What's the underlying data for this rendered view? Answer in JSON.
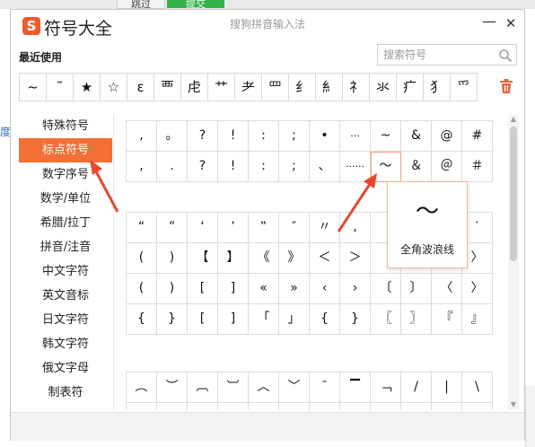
{
  "background": {
    "tab_skip": "跳过",
    "tab_submit": "提交",
    "left_link": "度"
  },
  "window": {
    "logo_letter": "S",
    "title": "符号大全",
    "ime_name": "搜狗拼音输入法",
    "minimize_symbol": "—",
    "close_symbol": "✕"
  },
  "recent": {
    "label": "最近使用",
    "symbols": [
      "~",
      "˜",
      "★",
      "☆",
      "ε",
      "覀",
      "虍",
      "艹",
      "耂",
      "罒",
      "纟",
      "糹",
      "礻",
      "氺",
      "疒",
      "犭",
      "爫"
    ]
  },
  "search": {
    "placeholder": "搜索符号"
  },
  "sidebar": {
    "items": [
      {
        "label": "特殊符号",
        "active": false
      },
      {
        "label": "标点符号",
        "active": true
      },
      {
        "label": "数字序号",
        "active": false
      },
      {
        "label": "数学/单位",
        "active": false
      },
      {
        "label": "希腊/拉丁",
        "active": false
      },
      {
        "label": "拼音/注音",
        "active": false
      },
      {
        "label": "中文字符",
        "active": false
      },
      {
        "label": "英文音标",
        "active": false
      },
      {
        "label": "日文字符",
        "active": false
      },
      {
        "label": "韩文字符",
        "active": false
      },
      {
        "label": "俄文字母",
        "active": false
      },
      {
        "label": "制表符",
        "active": false
      }
    ]
  },
  "grid1": [
    [
      ",",
      "。",
      "?",
      "!",
      ":",
      ";",
      "•",
      "···",
      "~",
      "&",
      "@",
      "#"
    ],
    [
      ",",
      ".",
      "?",
      "!",
      ":",
      ";",
      "、",
      "······",
      "～",
      "＆",
      "＠",
      "＃"
    ]
  ],
  "grid2": [
    [
      "“",
      "”",
      "‘",
      "’",
      "‟",
      "″",
      "〃",
      "‚",
      "",
      "",
      "",
      "′"
    ],
    [
      "(",
      ")",
      "【",
      "】",
      "《",
      "》",
      "＜",
      "＞",
      "",
      "",
      "",
      "〉"
    ],
    [
      "(",
      ")",
      "[",
      "]",
      "«",
      "»",
      "‹",
      "›",
      "〔",
      "〕",
      "〈",
      "〉"
    ],
    [
      "{",
      "}",
      "[",
      "]",
      "「",
      "」",
      "{",
      "}",
      "〖",
      "〗",
      "『",
      "』"
    ]
  ],
  "grid3": [
    [
      "︵",
      "︶",
      "︹",
      "︺",
      "︿",
      "﹀",
      "¯",
      "▔",
      "﹁",
      "/",
      "|",
      "\\"
    ],
    [
      "",
      "",
      "",
      "",
      "",
      "",
      "",
      "",
      "",
      "",
      "",
      ""
    ]
  ],
  "highlight": {
    "row": 1,
    "col": 8
  },
  "tooltip": {
    "symbol": "～",
    "name": "全角波浪线"
  },
  "colors": {
    "accent": "#f26f35",
    "arrow": "#e8492f",
    "logo": "#ee5b2b"
  }
}
